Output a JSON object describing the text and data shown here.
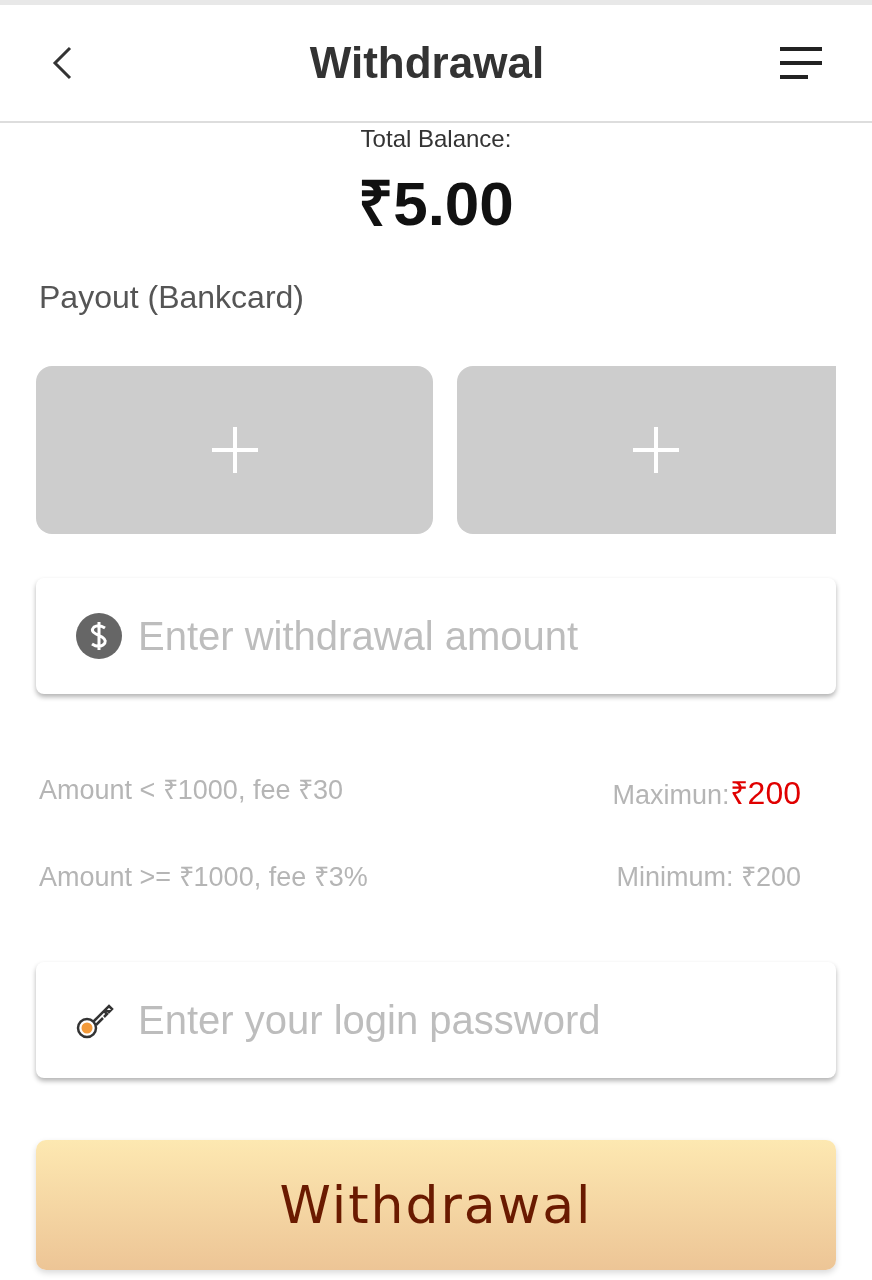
{
  "header": {
    "title": "Withdrawal"
  },
  "balance": {
    "label": "Total Balance:",
    "amount": "₹5.00"
  },
  "payout": {
    "label": "Payout (Bankcard)",
    "cards": [
      {
        "kind": "add"
      },
      {
        "kind": "add"
      }
    ]
  },
  "amount_field": {
    "placeholder": "Enter withdrawal amount"
  },
  "limits": [
    {
      "left": "Amount < ₹1000, fee ₹30",
      "right_label": "Maximun:",
      "right_value": "₹200"
    },
    {
      "left": "Amount >= ₹1000, fee ₹3%",
      "right_label": "Minimum: ₹200"
    }
  ],
  "password_field": {
    "placeholder": "Enter your login password"
  },
  "submit": {
    "label": "Withdrawal"
  }
}
